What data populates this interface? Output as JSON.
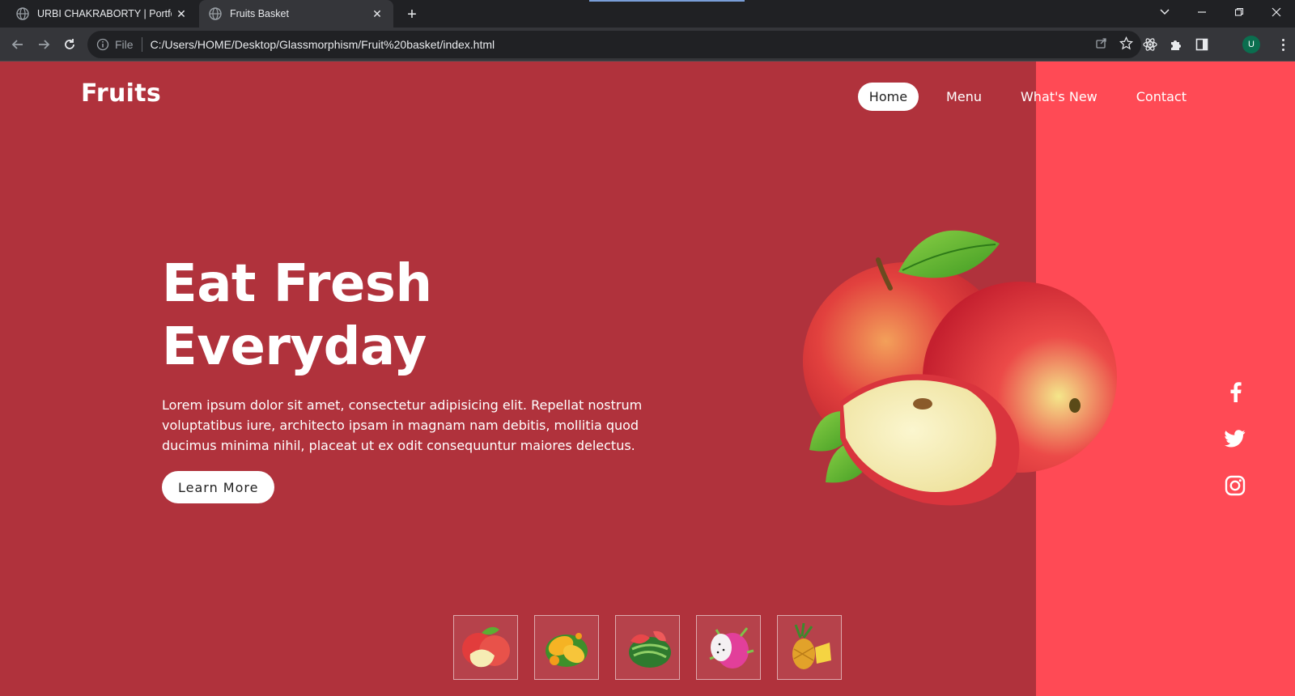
{
  "browser": {
    "tabs": [
      {
        "title": "URBI CHAKRABORTY | Portfolio",
        "active": false
      },
      {
        "title": "Fruits Basket",
        "active": true
      }
    ],
    "address": {
      "scheme": "File",
      "url": "C:/Users/HOME/Desktop/Glassmorphism/Fruit%20basket/index.html"
    },
    "profile_initial": "U"
  },
  "site": {
    "brand": "Fruits",
    "nav": [
      {
        "label": "Home",
        "active": true
      },
      {
        "label": "Menu",
        "active": false
      },
      {
        "label": "What's New",
        "active": false
      },
      {
        "label": "Contact",
        "active": false
      }
    ],
    "hero": {
      "title_line1": "Eat Fresh",
      "title_line2": "Everyday",
      "text": "Lorem ipsum dolor sit amet, consectetur adipisicing elit. Repellat nostrum voluptatibus iure, architecto ipsam in magnam nam debitis, mollitia quod ducimus minima nihil, placeat ut ex odit consequuntur maiores delectus.",
      "button": "Learn More",
      "image": "apples-illustration"
    },
    "socials": [
      "facebook-icon",
      "twitter-icon",
      "instagram-icon"
    ],
    "thumbnails": [
      "apple",
      "mango",
      "watermelon",
      "dragon-fruit",
      "pineapple"
    ]
  },
  "colors": {
    "page_bg": "#b0323c",
    "side_panel": "#ff4a55",
    "chrome_dark": "#202124",
    "chrome_toolbar": "#35363a"
  }
}
